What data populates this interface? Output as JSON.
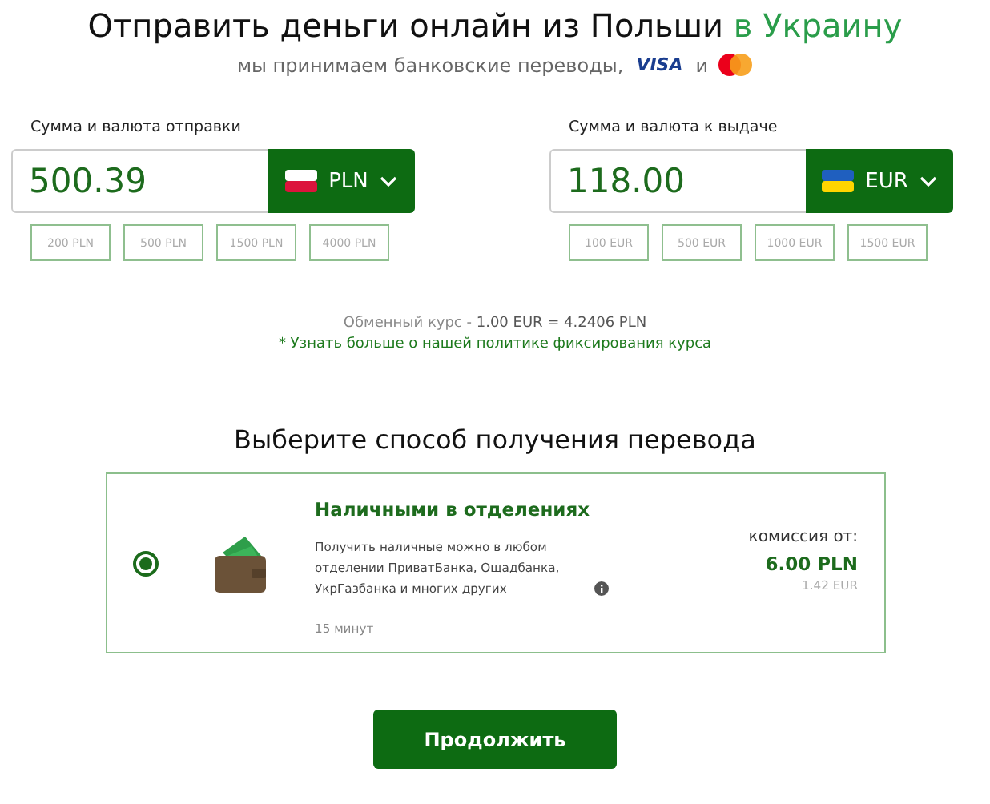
{
  "title": {
    "main": "Отправить деньги онлайн из Польши",
    "accent": "в Украину"
  },
  "subtitle": {
    "text": "мы принимаем банковские переводы,",
    "visa": "VISA",
    "and": "и"
  },
  "amounts": [
    {
      "label": "Сумма и валюта отправки",
      "value": "500.39",
      "currency": "PLN",
      "flag": {
        "kind": "poland"
      },
      "presets": [
        "200 PLN",
        "500 PLN",
        "1500 PLN",
        "4000 PLN"
      ]
    },
    {
      "label": "Сумма и валюта к выдаче",
      "value": "118.00",
      "currency": "EUR",
      "flag": {
        "kind": "ukraine"
      },
      "presets": [
        "100 EUR",
        "500 EUR",
        "1000 EUR",
        "1500 EUR"
      ]
    }
  ],
  "rate": {
    "label": "Обменный курс -",
    "value": "1.00 EUR = 4.2406 PLN"
  },
  "policy_link": "* Узнать больше о нашей политике фиксирования курса",
  "method_heading": "Выберите способ получения перевода",
  "methods": [
    {
      "selected": true,
      "title": "Наличными в отделениях",
      "description": "Получить наличные можно в любом отделении ПриватБанка, Ощадбанка, УкрГазбанка и многих других",
      "time": "15 минут",
      "fee_label": "комиссия от:",
      "fee": "6.00 PLN",
      "fee_alt": "1.42 EUR"
    }
  ],
  "continue_button": "Продолжить"
}
